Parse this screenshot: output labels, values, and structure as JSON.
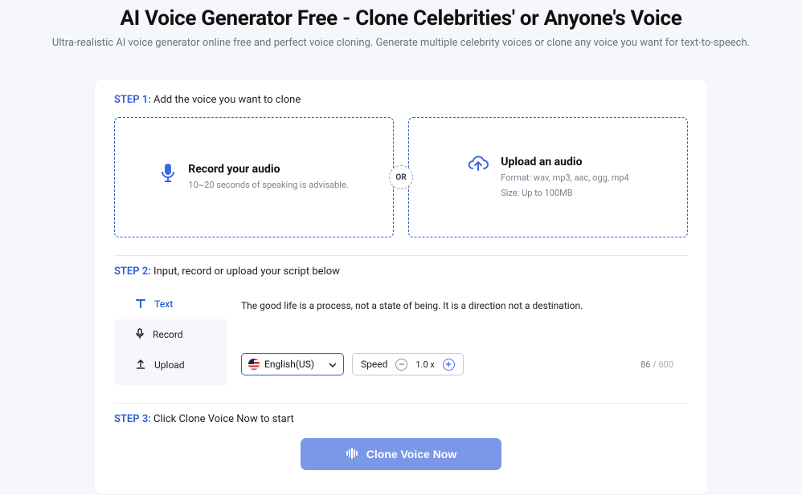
{
  "title": "AI Voice Generator Free - Clone Celebrities' or Anyone's Voice",
  "subtitle": "Ultra-realistic AI voice generator online free and perfect voice cloning. Generate multiple celebrity voices or clone any voice you want for text-to-speech.",
  "step1": {
    "num": "STEP 1:",
    "text": "Add the voice you want to clone",
    "record": {
      "title": "Record your audio",
      "sub": "10~20 seconds of speaking is advisable."
    },
    "or": "OR",
    "upload": {
      "title": "Upload an audio",
      "line1": "Format: wav, mp3, aac, ogg, mp4",
      "line2": "Size: Up to 100MB"
    }
  },
  "step2": {
    "num": "STEP 2:",
    "text": "Input, record or upload your script below",
    "tabs": {
      "text": "Text",
      "record": "Record",
      "upload": "Upload"
    },
    "script": "The good life is a process, not a state of being. It is a direction not a destination.",
    "language": "English(US)",
    "speed_label": "Speed",
    "speed_value": "1.0 x",
    "count_current": "86",
    "count_sep": "  /  ",
    "count_max": "600"
  },
  "step3": {
    "num": "STEP 3:",
    "text": "Click Clone Voice Now to start",
    "cta": "Clone Voice Now"
  }
}
